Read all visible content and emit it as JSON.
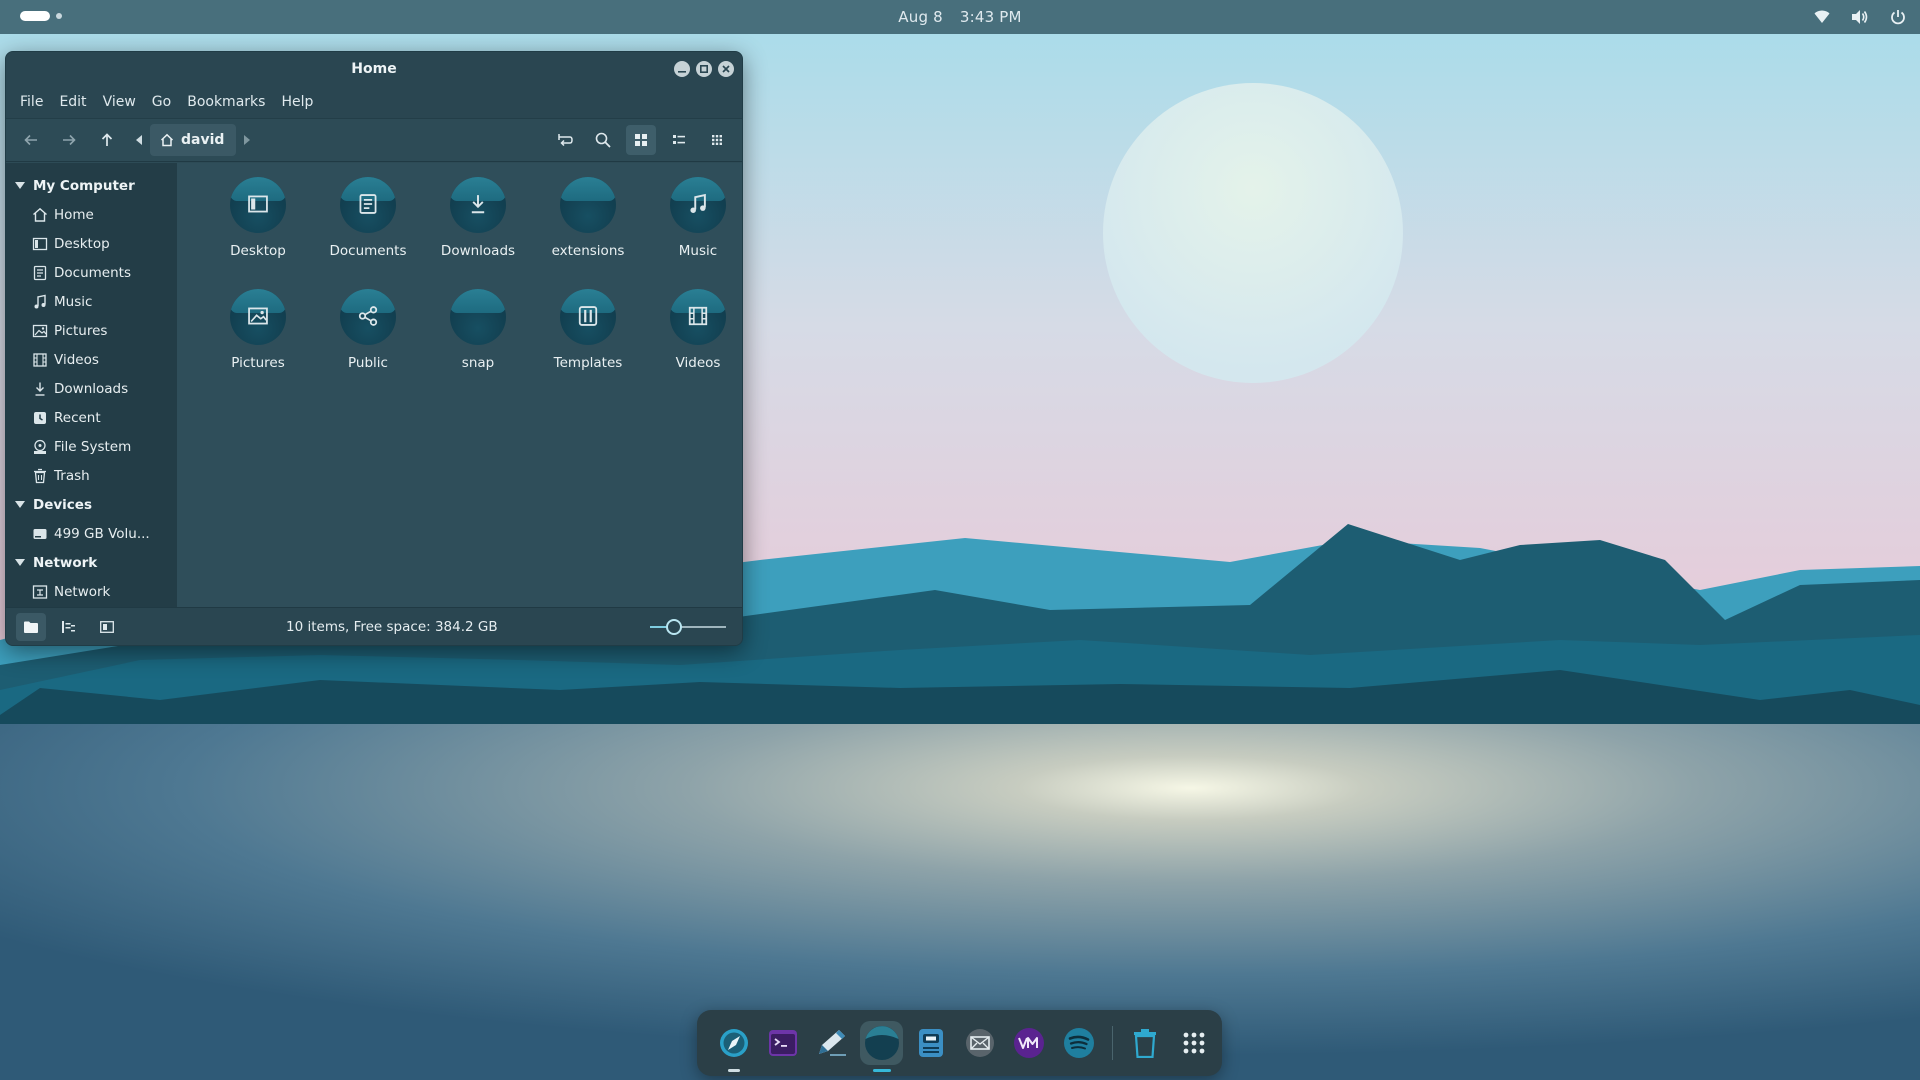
{
  "topbar": {
    "date": "Aug 8",
    "time": "3:43 PM",
    "tray_icons": [
      "wifi-icon",
      "volume-icon",
      "power-icon"
    ]
  },
  "window": {
    "title": "Home",
    "menu": [
      "File",
      "Edit",
      "View",
      "Go",
      "Bookmarks",
      "Help"
    ],
    "breadcrumb": "david",
    "sidebar": {
      "sections": [
        {
          "title": "My Computer",
          "items": [
            {
              "label": "Home",
              "icon": "home-icon"
            },
            {
              "label": "Desktop",
              "icon": "desktop-icon"
            },
            {
              "label": "Documents",
              "icon": "document-icon"
            },
            {
              "label": "Music",
              "icon": "music-icon"
            },
            {
              "label": "Pictures",
              "icon": "picture-icon"
            },
            {
              "label": "Videos",
              "icon": "video-icon"
            },
            {
              "label": "Downloads",
              "icon": "download-icon"
            },
            {
              "label": "Recent",
              "icon": "recent-icon"
            },
            {
              "label": "File System",
              "icon": "drive-icon"
            },
            {
              "label": "Trash",
              "icon": "trash-icon"
            }
          ]
        },
        {
          "title": "Devices",
          "items": [
            {
              "label": "499 GB Volu...",
              "icon": "disk-icon"
            }
          ]
        },
        {
          "title": "Network",
          "items": [
            {
              "label": "Network",
              "icon": "network-icon"
            }
          ]
        }
      ]
    },
    "files": [
      {
        "name": "Desktop",
        "icon": "desktop-icon"
      },
      {
        "name": "Documents",
        "icon": "document-icon"
      },
      {
        "name": "Downloads",
        "icon": "download-icon"
      },
      {
        "name": "extensions",
        "icon": ""
      },
      {
        "name": "Music",
        "icon": "music-icon"
      },
      {
        "name": "Pictures",
        "icon": "picture-icon"
      },
      {
        "name": "Public",
        "icon": "share-icon"
      },
      {
        "name": "snap",
        "icon": ""
      },
      {
        "name": "Templates",
        "icon": "template-icon"
      },
      {
        "name": "Videos",
        "icon": "video-icon"
      }
    ],
    "status": "10 items, Free space: 384.2 GB",
    "zoom_level": 0.27
  },
  "dock": {
    "apps": [
      {
        "name": "web-browser",
        "running": true,
        "focused": false
      },
      {
        "name": "terminal",
        "running": false,
        "focused": false
      },
      {
        "name": "text-editor",
        "running": false,
        "focused": false
      },
      {
        "name": "files",
        "running": true,
        "focused": true
      },
      {
        "name": "disk-utility",
        "running": false,
        "focused": false
      },
      {
        "name": "mail",
        "running": false,
        "focused": false
      },
      {
        "name": "vm-manager",
        "running": false,
        "focused": false
      },
      {
        "name": "spotify",
        "running": false,
        "focused": false
      }
    ]
  },
  "colors": {
    "sky_top": "#a8dcea",
    "sky_bottom": "#e7c8d6",
    "water": "#3e6b83",
    "accent": "#36b8d8"
  }
}
